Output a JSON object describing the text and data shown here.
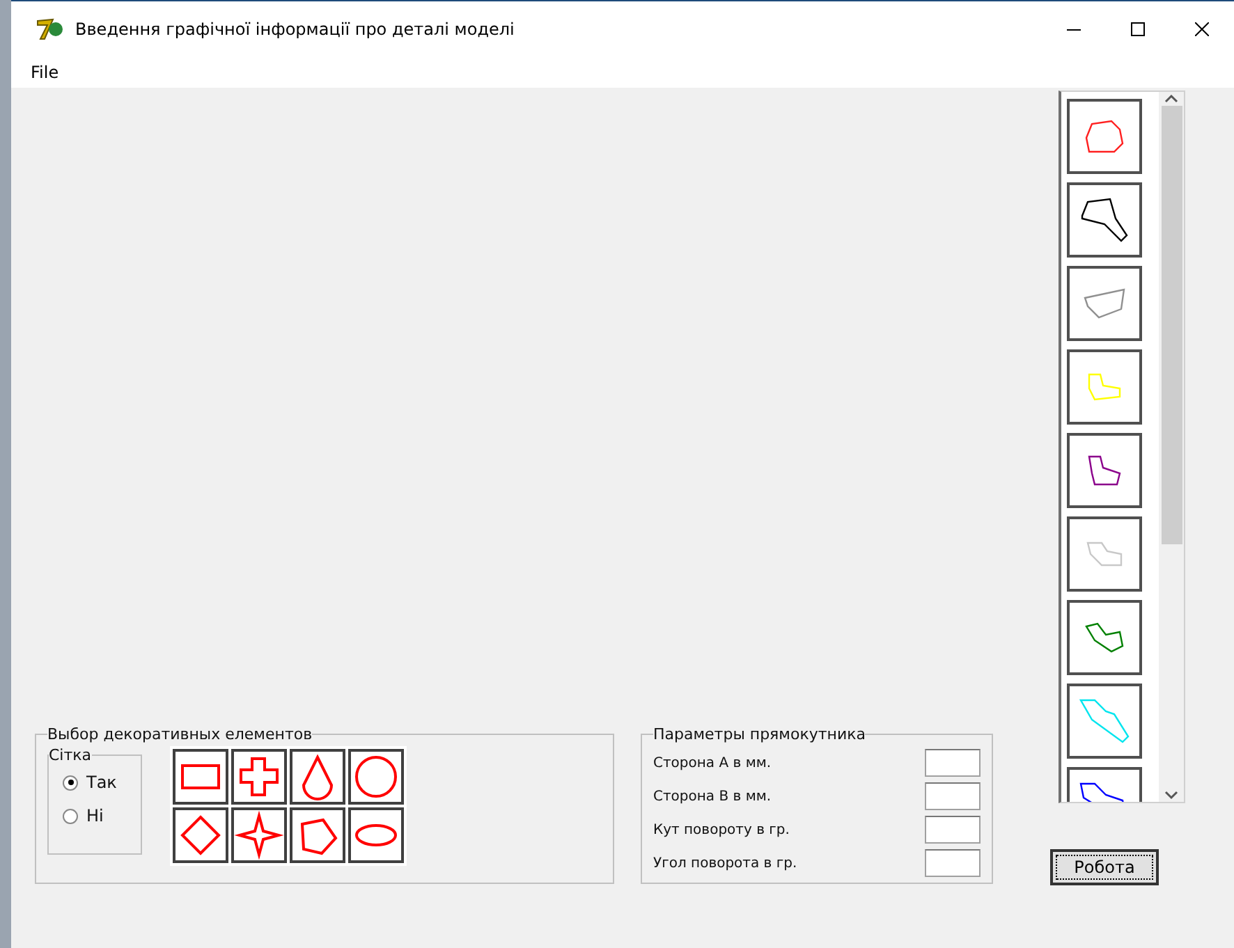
{
  "window": {
    "title": "Введення графічної інформації про деталі моделі"
  },
  "menu": [
    {
      "label": "File"
    }
  ],
  "part_list": [
    {
      "color": "#ff2020"
    },
    {
      "color": "#000000"
    },
    {
      "color": "#909090"
    },
    {
      "color": "#ffff00"
    },
    {
      "color": "#8b008b"
    },
    {
      "color": "#c8c8c8"
    },
    {
      "color": "#008000"
    },
    {
      "color": "#00e5ee"
    },
    {
      "color": "#0000ff"
    }
  ],
  "decor_group": {
    "title": "Выбор декоративных елементов",
    "grid_group": {
      "title": "Сітка",
      "options": [
        {
          "label": "Так",
          "selected": true
        },
        {
          "label": "Ні",
          "selected": false
        }
      ]
    },
    "elements": [
      {
        "kind": "rectangle"
      },
      {
        "kind": "cross"
      },
      {
        "kind": "drop"
      },
      {
        "kind": "circle"
      },
      {
        "kind": "diamond"
      },
      {
        "kind": "star"
      },
      {
        "kind": "pentagon"
      },
      {
        "kind": "ellipse"
      }
    ]
  },
  "rect_group": {
    "title": "Параметры прямокутника",
    "fields": [
      {
        "label": "Сторона А в мм."
      },
      {
        "label": "Сторона В в мм."
      },
      {
        "label": "Кут повороту в гр."
      },
      {
        "label": "Угол поворота в гр."
      }
    ]
  },
  "buttons": [
    {
      "label": "Робота"
    }
  ]
}
